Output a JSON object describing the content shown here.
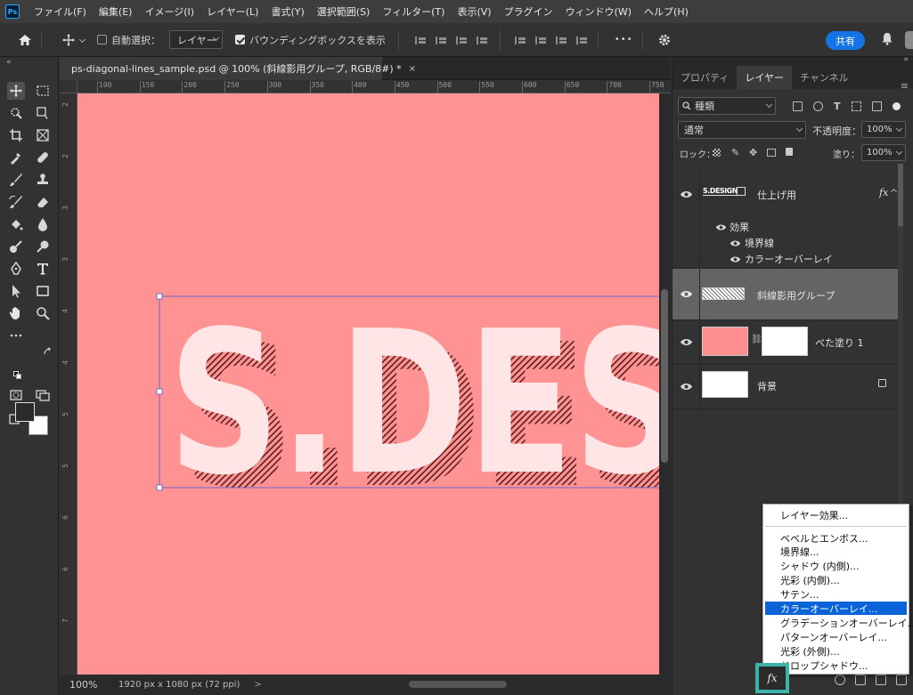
{
  "app": {
    "name": "Ps"
  },
  "menu": [
    "ファイル(F)",
    "編集(E)",
    "イメージ(I)",
    "レイヤー(L)",
    "書式(Y)",
    "選択範囲(S)",
    "フィルター(T)",
    "表示(V)",
    "プラグイン",
    "ウィンドウ(W)",
    "ヘルプ(H)"
  ],
  "options": {
    "auto_select_label": "自動選択：",
    "auto_select_value": "レイヤー",
    "bounding_box_label": "バウンディングボックスを表示",
    "more": "•••",
    "share_label": "共有"
  },
  "document": {
    "tab_title": "ps-diagonal-lines_sample.psd @ 100% (斜線影用グループ, RGB/8#) *",
    "close": "×",
    "zoom": "100%",
    "size": "1920 px x 1080 px (72 ppi)",
    "status_arrow": ">",
    "canvas_color": "#ff9292",
    "text": "S.DES"
  },
  "ruler_top": [
    "100",
    "150",
    "200",
    "250",
    "300",
    "350",
    "400",
    "450",
    "500",
    "550",
    "600",
    "650",
    "700",
    "750"
  ],
  "ruler_left": [
    "2",
    "2",
    "3",
    "3",
    "4",
    "4",
    "5",
    "5",
    "6",
    "6",
    "7"
  ],
  "panel": {
    "tabs": [
      "プロパティ",
      "レイヤー",
      "チャンネル"
    ],
    "kind_label": "種類",
    "blend_mode": "通常",
    "opacity_label": "不透明度：",
    "opacity_value": "100%",
    "lock_label": "ロック：",
    "fill_label": "塗り：",
    "fill_value": "100%"
  },
  "layers": [
    {
      "name": "仕上げ用",
      "fx": "fx"
    },
    {
      "name": "斜線影用グループ"
    },
    {
      "name": "べた塗り 1"
    },
    {
      "name": "背景"
    }
  ],
  "effects": {
    "label": "効果",
    "items": [
      "境界線",
      "カラーオーバーレイ"
    ]
  },
  "context_menu": {
    "header": "レイヤー効果...",
    "items": [
      "ベベルとエンボス...",
      "境界線...",
      "シャドウ (内側)...",
      "光彩 (内側)...",
      "サテン...",
      "カラーオーバーレイ...",
      "グラデーションオーバーレイ...",
      "パターンオーバーレイ...",
      "光彩 (外側)...",
      "ドロップシャドウ..."
    ],
    "highlight_index": 5
  },
  "fx_button": "fx"
}
